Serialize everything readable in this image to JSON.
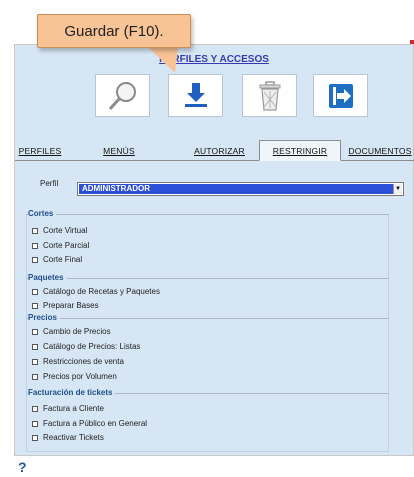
{
  "tooltip": {
    "text": "Guardar (F10)."
  },
  "window": {
    "title": "PERFILES Y ACCESOS"
  },
  "toolbar": {
    "buttons": [
      {
        "icon": "search-icon"
      },
      {
        "icon": "save-icon"
      },
      {
        "icon": "trash-icon"
      },
      {
        "icon": "exit-icon"
      }
    ]
  },
  "tabs": [
    {
      "label": "PERFILES"
    },
    {
      "label": "MENÚS"
    },
    {
      "label": "AUTORIZAR"
    },
    {
      "label": "RESTRINGIR",
      "active": true
    },
    {
      "label": "DOCUMENTOS"
    }
  ],
  "perfil": {
    "label": "Perfil",
    "value": "ADMINISTRADOR"
  },
  "groups": [
    {
      "label": "Cortes",
      "items": [
        "Corte Virtual",
        "Corte Parcial",
        "Corte Final"
      ]
    },
    {
      "label": "Paquetes",
      "items": [
        "Catálogo de Recetas y Paquetes",
        "Preparar Bases"
      ]
    },
    {
      "label": "Precios",
      "items": [
        "Cambio de Precios",
        "Catálogo de Precios: Listas",
        "Restricciones de venta",
        "Precios por Volumen"
      ]
    },
    {
      "label": "Facturación de tickets",
      "items": [
        "Factura a Cliente",
        "Factura a Público en General",
        "Reactivar Tickets"
      ]
    }
  ],
  "colors": {
    "accent": "#1f4e8c",
    "panel": "#d6e6f4",
    "selected": "#2b4fd6",
    "tooltip": "#f8c395"
  }
}
